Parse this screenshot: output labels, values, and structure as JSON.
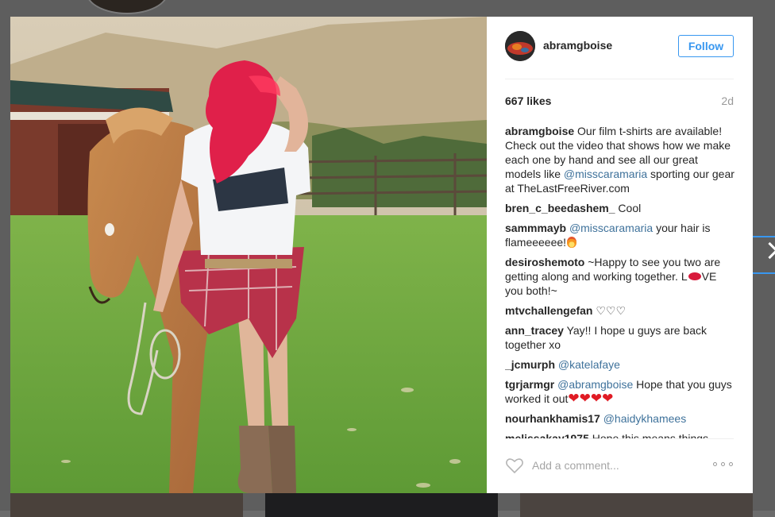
{
  "post": {
    "username": "abramgboise",
    "follow_label": "Follow",
    "likes": "667 likes",
    "age": "2d"
  },
  "caption": {
    "author": "abramgboise",
    "text_1": "Our film t-shirts are available! Check out the video that shows how we make each one by hand and see all our great models like ",
    "mention": "@misscaramaria",
    "text_2": " sporting our gear at TheLastFreeRiver.com"
  },
  "comments": [
    {
      "author": "bren_c_beedashem_",
      "text": "Cool"
    },
    {
      "author": "sammmayb",
      "mention": "@misscaramaria",
      "text": "your hair is flameeeeee!"
    },
    {
      "author": "desiroshemoto",
      "text_1": "~Happy to see you two are getting along and working together. L",
      "text_2": "VE you both!~"
    },
    {
      "author": "mtvchallengefan",
      "text": "♡♡♡"
    },
    {
      "author": "ann_tracey",
      "text": "Yay!! I hope u guys are back together xo"
    },
    {
      "author": "_jcmurph",
      "mention": "@katelafaye"
    },
    {
      "author": "tgrjarmgr",
      "mention": "@abramgboise",
      "text": "Hope that you guys worked it out",
      "hearts": "❤❤❤❤"
    },
    {
      "author": "nourhankhamis17",
      "mention": "@haidykhamees"
    },
    {
      "author": "melissakay1975",
      "text": "Hope this means things"
    }
  ],
  "add_comment": {
    "placeholder": "Add a comment..."
  },
  "icons": {
    "like": "heart-outline-icon",
    "more": "more-options-icon",
    "next": "chevron-right-icon"
  },
  "colors": {
    "accent": "#3897f0",
    "mention": "#3f729b",
    "muted": "#999999"
  }
}
